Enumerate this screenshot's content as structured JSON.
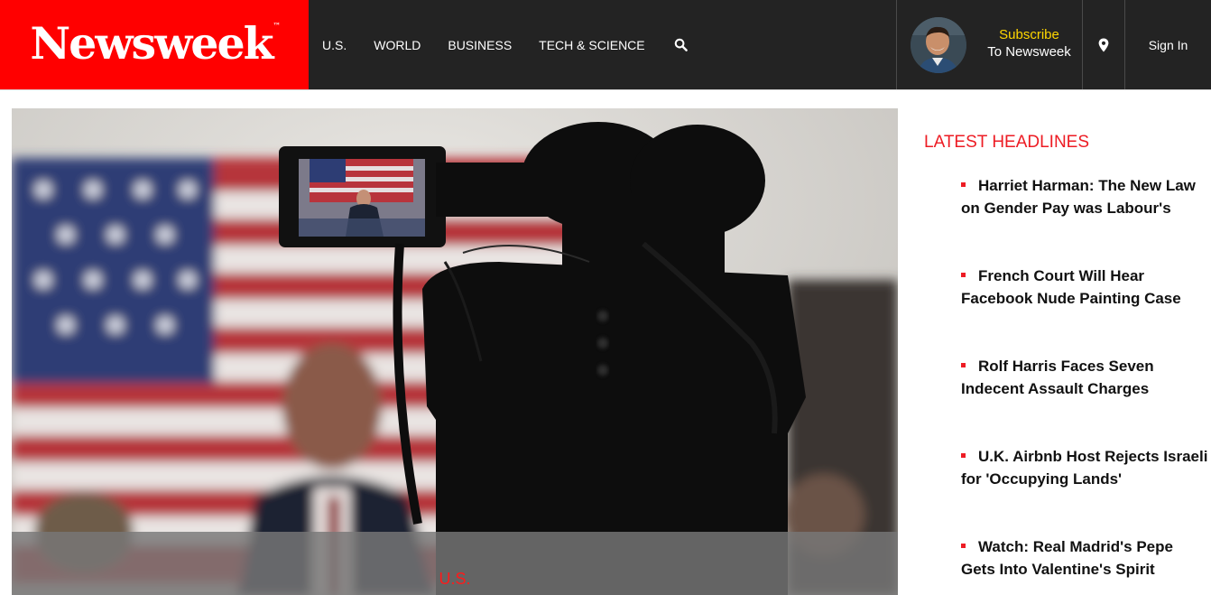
{
  "brand": {
    "name": "Newsweek",
    "trademark": "™"
  },
  "nav": {
    "items": [
      "U.S.",
      "WORLD",
      "BUSINESS",
      "TECH & SCIENCE"
    ],
    "search_icon": "search-icon"
  },
  "subscribe": {
    "line1": "Subscribe",
    "line2": "To Newsweek"
  },
  "location_icon": "map-marker-icon",
  "signin": {
    "label": "Sign In"
  },
  "hero": {
    "section_label": "U.S."
  },
  "latest": {
    "title": "LATEST HEADLINES",
    "headlines": [
      "Harriet Harman: The New Law on Gender Pay was Labour's",
      "French Court Will Hear Facebook Nude Painting Case",
      "Rolf Harris Faces Seven Indecent Assault Charges",
      "U.K. Airbnb Host Rejects Israeli for 'Occupying Lands'",
      "Watch: Real Madrid's Pepe Gets Into Valentine's Spirit"
    ]
  },
  "colors": {
    "brand_red": "#ff0000",
    "header_bg": "#232323",
    "subscribe_accent": "#ffd600",
    "headline_red": "#ed1c24"
  }
}
